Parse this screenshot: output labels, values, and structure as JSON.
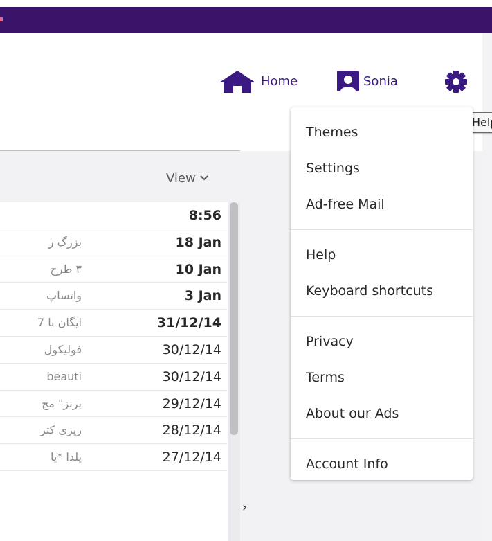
{
  "header": {
    "home_label": "Home",
    "user_label": "Sonia",
    "tooltip_text": "Help"
  },
  "list": {
    "view_label": "View",
    "rows": [
      {
        "subject": "",
        "date": "8:56",
        "unread": true
      },
      {
        "subject": "بزرگ ر",
        "date": "18 Jan",
        "unread": true
      },
      {
        "subject": "۳ طرح",
        "date": "10 Jan",
        "unread": true
      },
      {
        "subject": "واتساپ",
        "date": "3 Jan",
        "unread": true
      },
      {
        "subject": "ایگان با 7",
        "date": "31/12/14",
        "unread": true
      },
      {
        "subject": "فولیکول",
        "date": "30/12/14",
        "unread": false
      },
      {
        "subject": "beauti",
        "date": "30/12/14",
        "unread": false
      },
      {
        "subject": "برنز\" مج",
        "date": "29/12/14",
        "unread": false
      },
      {
        "subject": "ریزی کتر",
        "date": "28/12/14",
        "unread": false
      },
      {
        "subject": "یلدا *یا",
        "date": "27/12/14",
        "unread": false
      }
    ]
  },
  "menu": {
    "groups": [
      [
        "Themes",
        "Settings",
        "Ad-free Mail"
      ],
      [
        "Help",
        "Keyboard shortcuts"
      ],
      [
        "Privacy",
        "Terms",
        "About our Ads"
      ],
      [
        "Account Info"
      ]
    ]
  },
  "colors": {
    "brand_purple": "#3a1468",
    "icon_purple": "#3a1a82"
  }
}
